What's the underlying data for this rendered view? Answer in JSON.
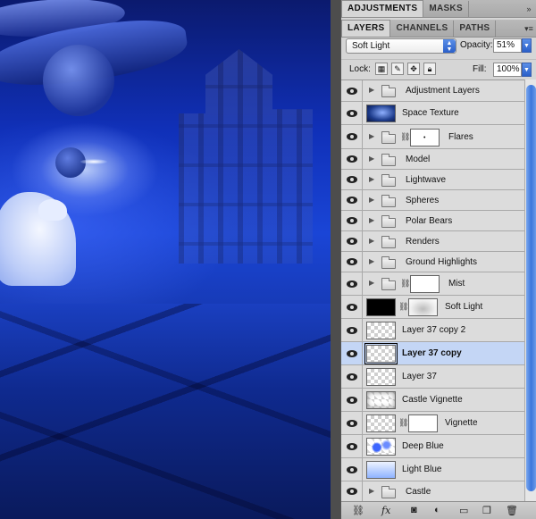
{
  "panel_tabs_top": {
    "adjustments": "ADJUSTMENTS",
    "masks": "MASKS"
  },
  "panel_tabs_layers": {
    "layers": "LAYERS",
    "channels": "CHANNELS",
    "paths": "PATHS"
  },
  "blend": {
    "mode": "Soft Light",
    "opacity_label": "Opacity:",
    "opacity_value": "51%"
  },
  "lock": {
    "label": "Lock:",
    "fill_label": "Fill:",
    "fill_value": "100%"
  },
  "layers": [
    {
      "name": "Adjustment Layers",
      "kind": "group"
    },
    {
      "name": "Space Texture",
      "kind": "image",
      "thumb": "space"
    },
    {
      "name": "Flares",
      "kind": "group-mask"
    },
    {
      "name": "Model",
      "kind": "group"
    },
    {
      "name": "Lightwave",
      "kind": "group"
    },
    {
      "name": "Spheres",
      "kind": "group"
    },
    {
      "name": "Polar Bears",
      "kind": "group"
    },
    {
      "name": "Renders",
      "kind": "group"
    },
    {
      "name": "Ground Highlights",
      "kind": "group"
    },
    {
      "name": "Mist",
      "kind": "group-mask"
    },
    {
      "name": "Soft Light",
      "kind": "image-mask",
      "thumb": "black"
    },
    {
      "name": "Layer 37 copy 2",
      "kind": "image",
      "thumb": "check"
    },
    {
      "name": "Layer 37 copy",
      "kind": "image",
      "thumb": "check",
      "selected": true
    },
    {
      "name": "Layer 37",
      "kind": "image",
      "thumb": "check"
    },
    {
      "name": "Castle Vignette",
      "kind": "image",
      "thumb": "vignette"
    },
    {
      "name": "Vignette",
      "kind": "image-mask",
      "thumb": "check"
    },
    {
      "name": "Deep Blue",
      "kind": "image",
      "thumb": "deepblue"
    },
    {
      "name": "Light Blue",
      "kind": "image",
      "thumb": "lightblue"
    },
    {
      "name": "Castle",
      "kind": "group"
    }
  ],
  "icons": {
    "eye": "eye-icon",
    "folder": "folder-icon",
    "link": "link-icon",
    "fx": "fx",
    "collapse": "»",
    "panel_menu": "▾≡"
  },
  "colors": {
    "selected_row": "#c4d6f5",
    "accent": "#3c76dc"
  }
}
